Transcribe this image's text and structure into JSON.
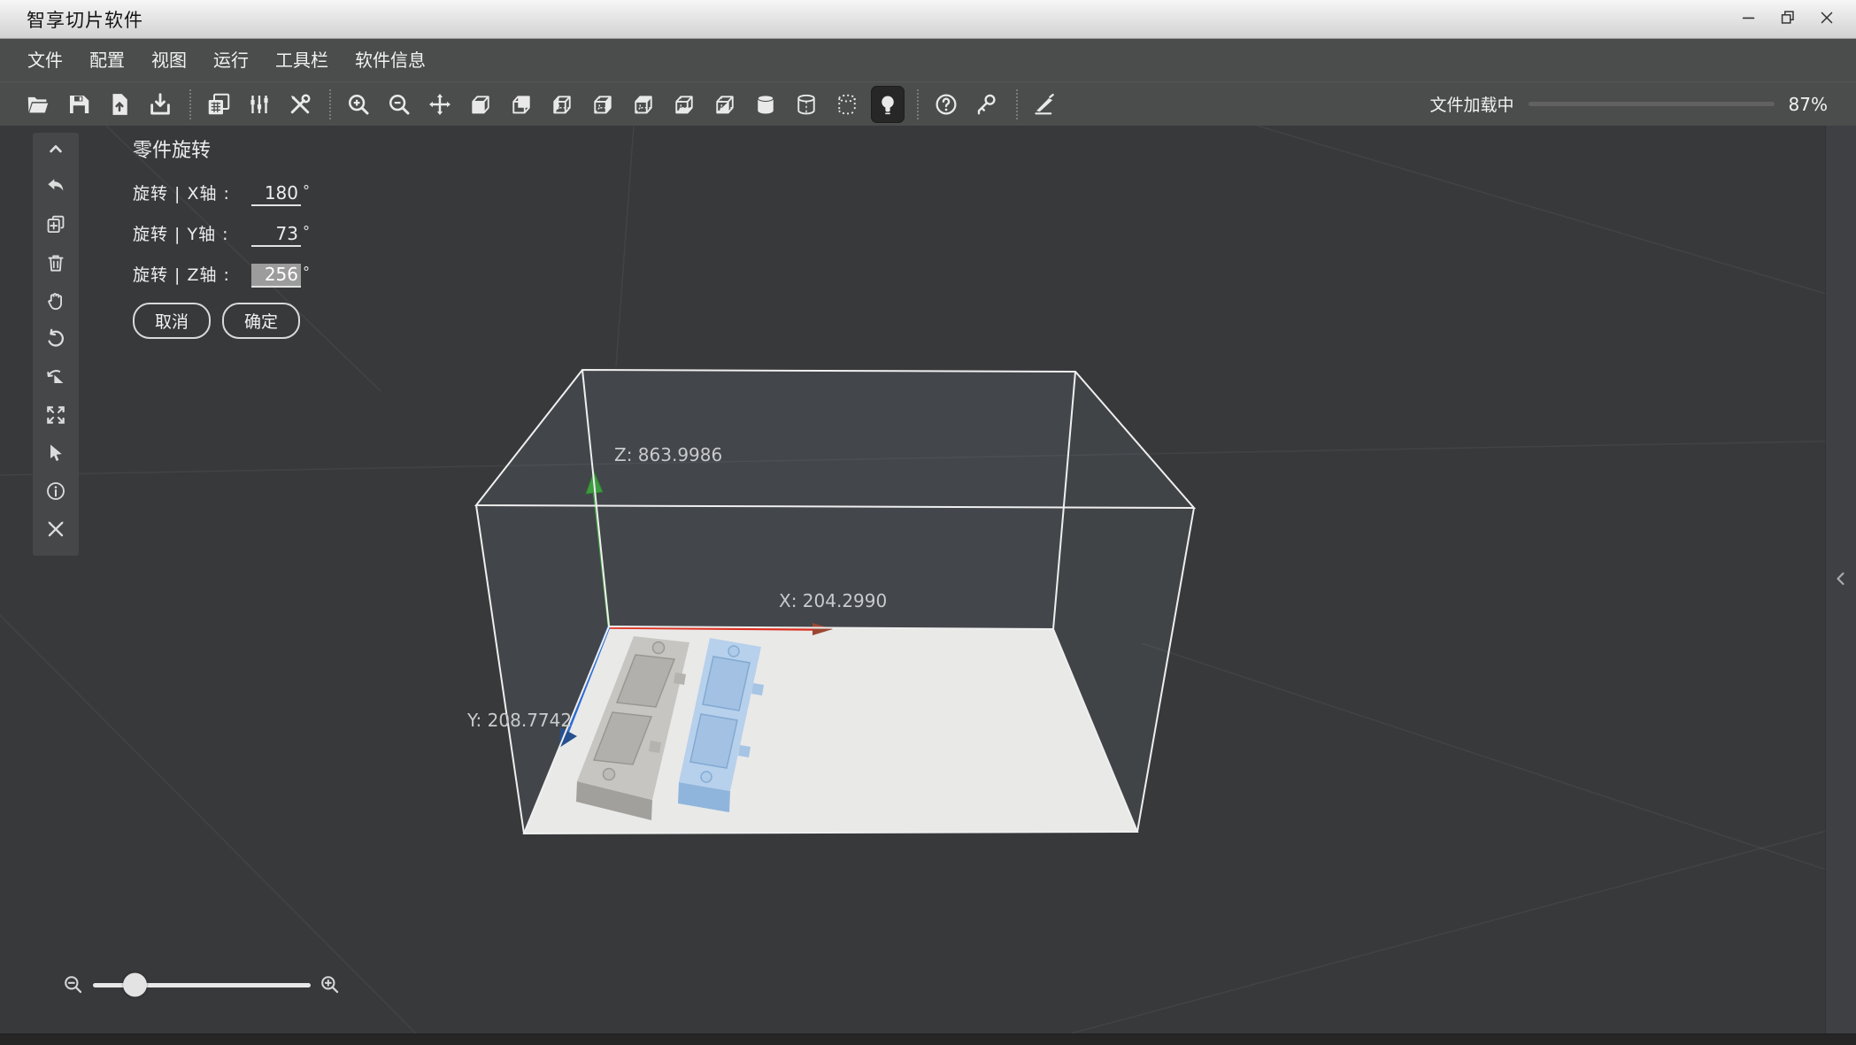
{
  "window": {
    "title": "智享切片软件",
    "controls": [
      "minimize",
      "restore",
      "close"
    ]
  },
  "menu": {
    "items": [
      {
        "id": "file",
        "label": "文件"
      },
      {
        "id": "config",
        "label": "配置"
      },
      {
        "id": "view",
        "label": "视图"
      },
      {
        "id": "run",
        "label": "运行"
      },
      {
        "id": "toolbar",
        "label": "工具栏"
      },
      {
        "id": "software-info",
        "label": "软件信息"
      }
    ]
  },
  "toolbar": {
    "groups": [
      [
        "open",
        "save",
        "import",
        "export"
      ],
      [
        "plate-copy",
        "adjust",
        "tools"
      ],
      [
        "zoom-in",
        "zoom-out",
        "move",
        "cube-front",
        "cube-back",
        "cube-left",
        "cube-right",
        "cube-top",
        "cube-bottom",
        "cube-section",
        "cylinder-solid",
        "cylinder-wire",
        "cylinder-points",
        "lightbulb"
      ],
      [
        "help",
        "key"
      ],
      [
        "knife"
      ]
    ],
    "active_item": "lightbulb",
    "progress": {
      "label": "文件加载中",
      "percent": 87,
      "percent_label": "87%"
    }
  },
  "sidebar": {
    "items": [
      "collapse-up",
      "undo",
      "duplicate",
      "delete",
      "pan-hand",
      "rotate",
      "mirror",
      "fit-expand",
      "select-pointer",
      "info",
      "repair-tools"
    ]
  },
  "rotation_panel": {
    "title": "零件旋转",
    "rows": [
      {
        "axis": "x",
        "label": "旋转 | X轴 :",
        "value": "180",
        "unit": "°",
        "selected": false
      },
      {
        "axis": "y",
        "label": "旋转 | Y轴 :",
        "value": "73",
        "unit": "°",
        "selected": false
      },
      {
        "axis": "z",
        "label": "旋转 | Z轴 :",
        "value": "256",
        "unit": "°",
        "selected": true
      }
    ],
    "cancel_label": "取消",
    "confirm_label": "确定"
  },
  "viewport": {
    "axis_labels": {
      "x": "X: 204.2990",
      "y": "Y: 208.7742",
      "z": "Z: 863.9986"
    },
    "axis_colors": {
      "x": "#dd2f1f",
      "y": "#2d6bd4",
      "z": "#3f9b41"
    },
    "zoom_slider_percent": 19
  },
  "colors": {
    "bar_bg": "#4b4d4c",
    "viewport_bg": "#37393b",
    "build_plate": "#e9e9e8",
    "model_gray": "#c6c5c2",
    "model_blue": "#b7d0ec"
  }
}
